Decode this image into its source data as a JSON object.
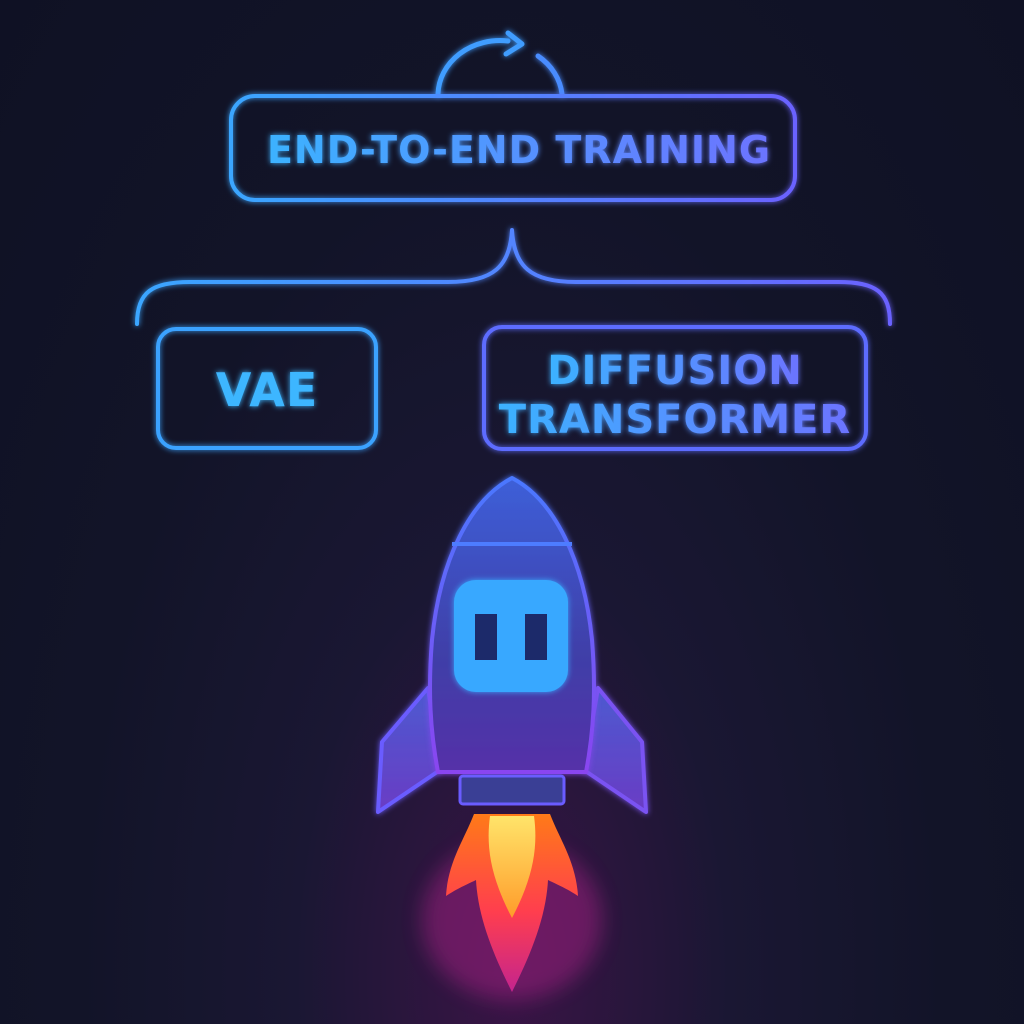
{
  "nodes": {
    "training": {
      "label": "END-TO-END TRAINING"
    },
    "vae": {
      "label": "VAE"
    },
    "dit": {
      "line1": "DIFFUSION",
      "line2": "TRANSFORMER"
    }
  },
  "icons": {
    "cycle": "cycle-arrow-icon",
    "rocket": "rocket-icon",
    "flame": "flame-icon"
  },
  "colors": {
    "background": "#12142a",
    "cyan": "#3fa9ff",
    "blue": "#4d7cff",
    "violet": "#6a5cff",
    "rocket_body": "#3b3f9a",
    "window": "#38a8ff",
    "flame_orange": "#ff6a1a",
    "flame_yellow": "#ffd23c",
    "flame_magenta": "#e2328a"
  }
}
